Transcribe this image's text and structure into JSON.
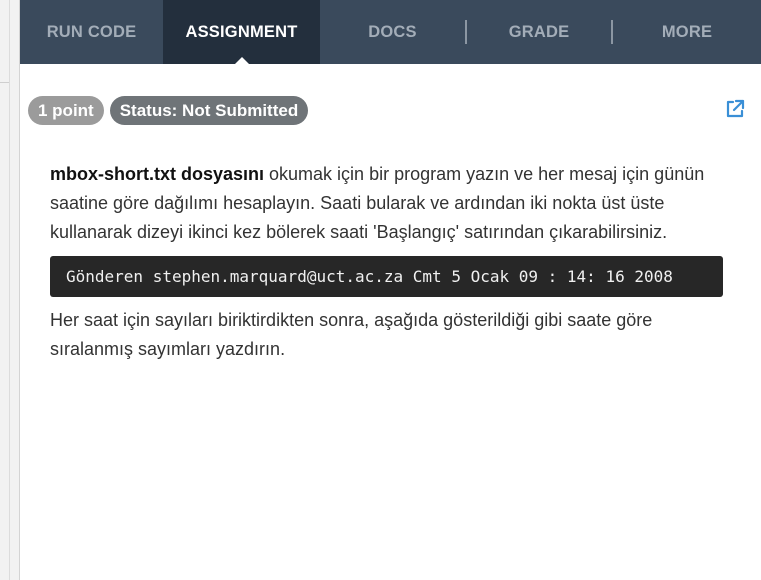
{
  "tabs": [
    {
      "label": "RUN CODE",
      "active": false
    },
    {
      "label": "ASSIGNMENT",
      "active": true
    },
    {
      "label": "DOCS",
      "active": false
    },
    {
      "label": "GRADE",
      "active": false
    },
    {
      "label": "MORE",
      "active": false
    }
  ],
  "badges": {
    "points": "1 point",
    "status": "Status: Not Submitted"
  },
  "assignment": {
    "intro_bold": "mbox-short.txt dosyasını",
    "intro_rest": " okumak için bir program yazın ve her mesaj için günün saatine göre dağılımı hesaplayın. Saati bularak ve ardından iki nokta üst üste kullanarak dizeyi ikinci kez bölerek saati 'Başlangıç' satırından çıkarabilirsiniz.",
    "code_line": "Gönderen stephen.marquard@uct.ac.za Cmt 5 Ocak 09 : 14: 16 2008",
    "after_code": "Her saat için sayıları biriktirdikten sonra, aşağıda gösterildiği gibi saate göre sıralanmış sayımları yazdırın."
  },
  "icons": {
    "external_link": "external-link-icon"
  },
  "colors": {
    "tabbar_bg": "#3a4a5c",
    "tab_active_bg": "#232f3d",
    "points_badge": "#9b9b9b",
    "status_badge": "#6f7478",
    "link_blue": "#3a8fd6",
    "code_bg": "#272727"
  }
}
